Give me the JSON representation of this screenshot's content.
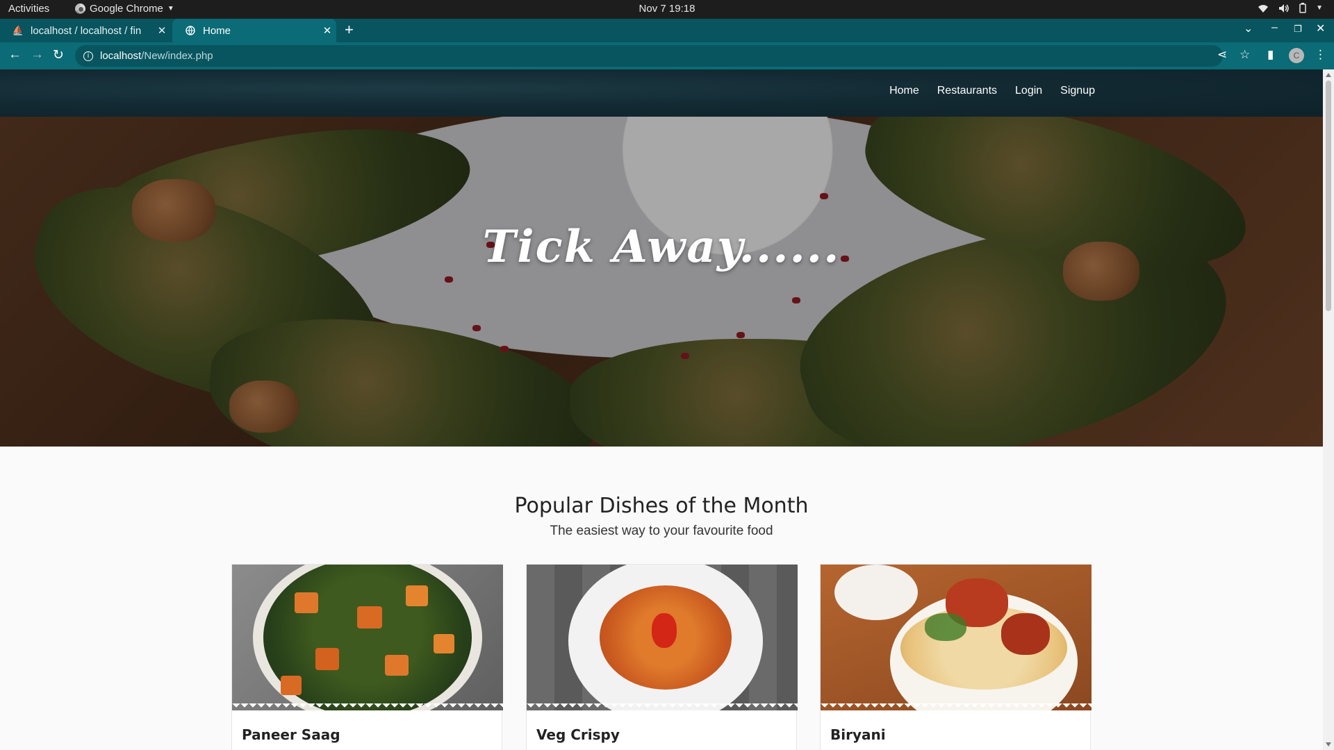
{
  "os_bar": {
    "activities": "Activities",
    "app_name": "Google Chrome",
    "clock": "Nov 7  19:18"
  },
  "browser": {
    "tabs": [
      {
        "title": "localhost / localhost / fin",
        "active": false
      },
      {
        "title": "Home",
        "active": true
      }
    ],
    "url_host": "localhost",
    "url_path": "/New/index.php",
    "profile_initial": "C"
  },
  "site": {
    "nav": [
      "Home",
      "Restaurants",
      "Login",
      "Signup"
    ],
    "hero_tagline": "Tick Away......",
    "section_title": "Popular Dishes of the Month",
    "section_subtitle": "The easiest way to your favourite food",
    "dishes": [
      {
        "name": "Paneer Saag"
      },
      {
        "name": "Veg Crispy"
      },
      {
        "name": "Biryani"
      }
    ]
  },
  "colors": {
    "tab_strip": "#08555f",
    "toolbar": "#0b6b76",
    "site_nav": "#132a33"
  }
}
